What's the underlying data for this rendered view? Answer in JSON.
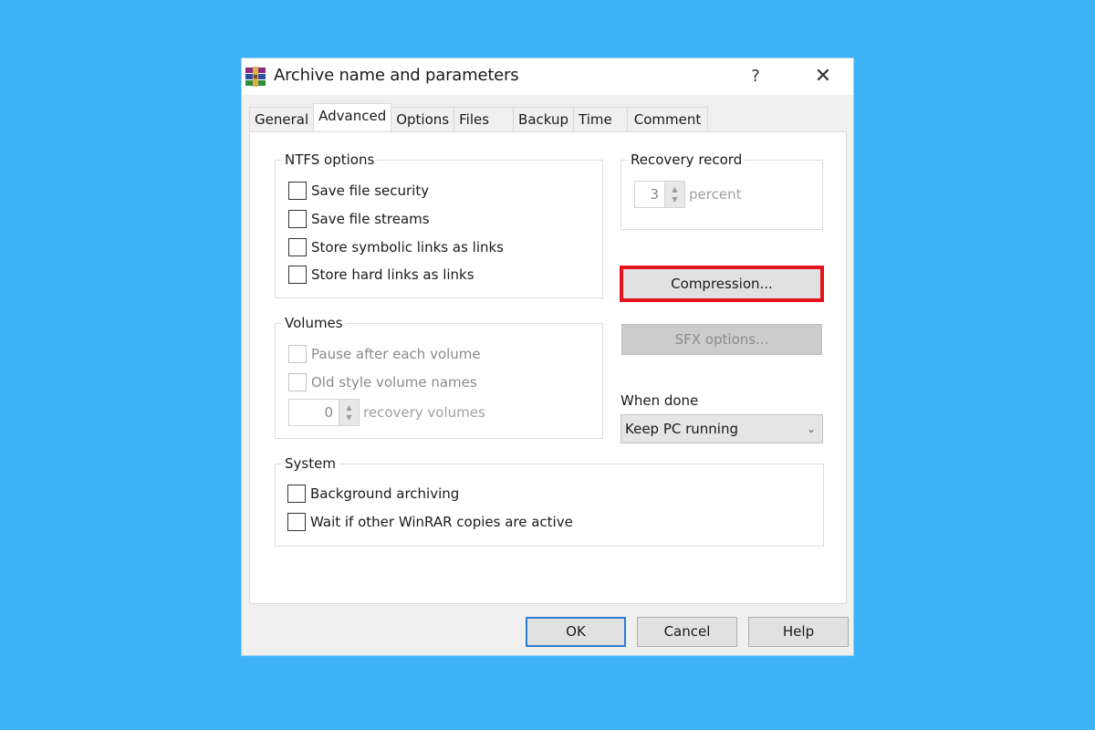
{
  "window": {
    "title": "Archive name and parameters",
    "icon": "winrar-icon",
    "help_label": "?",
    "close_label": "✕"
  },
  "tabs": [
    {
      "label": "General",
      "active": false
    },
    {
      "label": "Advanced",
      "active": true
    },
    {
      "label": "Options",
      "active": false
    },
    {
      "label": "Files",
      "active": false
    },
    {
      "label": "Backup",
      "active": false
    },
    {
      "label": "Time",
      "active": false
    },
    {
      "label": "Comment",
      "active": false
    }
  ],
  "ntfs": {
    "title": "NTFS options",
    "items": [
      {
        "label": "Save file security",
        "checked": false,
        "enabled": true
      },
      {
        "label": "Save file streams",
        "checked": false,
        "enabled": true
      },
      {
        "label": "Store symbolic links as links",
        "checked": false,
        "enabled": true
      },
      {
        "label": "Store hard links as links",
        "checked": false,
        "enabled": true
      }
    ]
  },
  "recovery_record": {
    "title": "Recovery record",
    "value": "3",
    "unit": "percent",
    "enabled": false
  },
  "buttons": {
    "compression": "Compression...",
    "sfx_options": "SFX options...",
    "ok": "OK",
    "cancel": "Cancel",
    "help": "Help"
  },
  "highlight_color": "#e3141b",
  "volumes": {
    "title": "Volumes",
    "items": [
      {
        "label": "Pause after each volume",
        "checked": false,
        "enabled": false
      },
      {
        "label": "Old style volume names",
        "checked": false,
        "enabled": false
      }
    ],
    "recovery_volumes_value": "0",
    "recovery_volumes_unit": "recovery volumes"
  },
  "when_done": {
    "label": "When done",
    "selected": "Keep PC running"
  },
  "system": {
    "title": "System",
    "items": [
      {
        "label": "Background archiving",
        "checked": false,
        "enabled": true
      },
      {
        "label": "Wait if other WinRAR copies are active",
        "checked": false,
        "enabled": true
      }
    ]
  }
}
